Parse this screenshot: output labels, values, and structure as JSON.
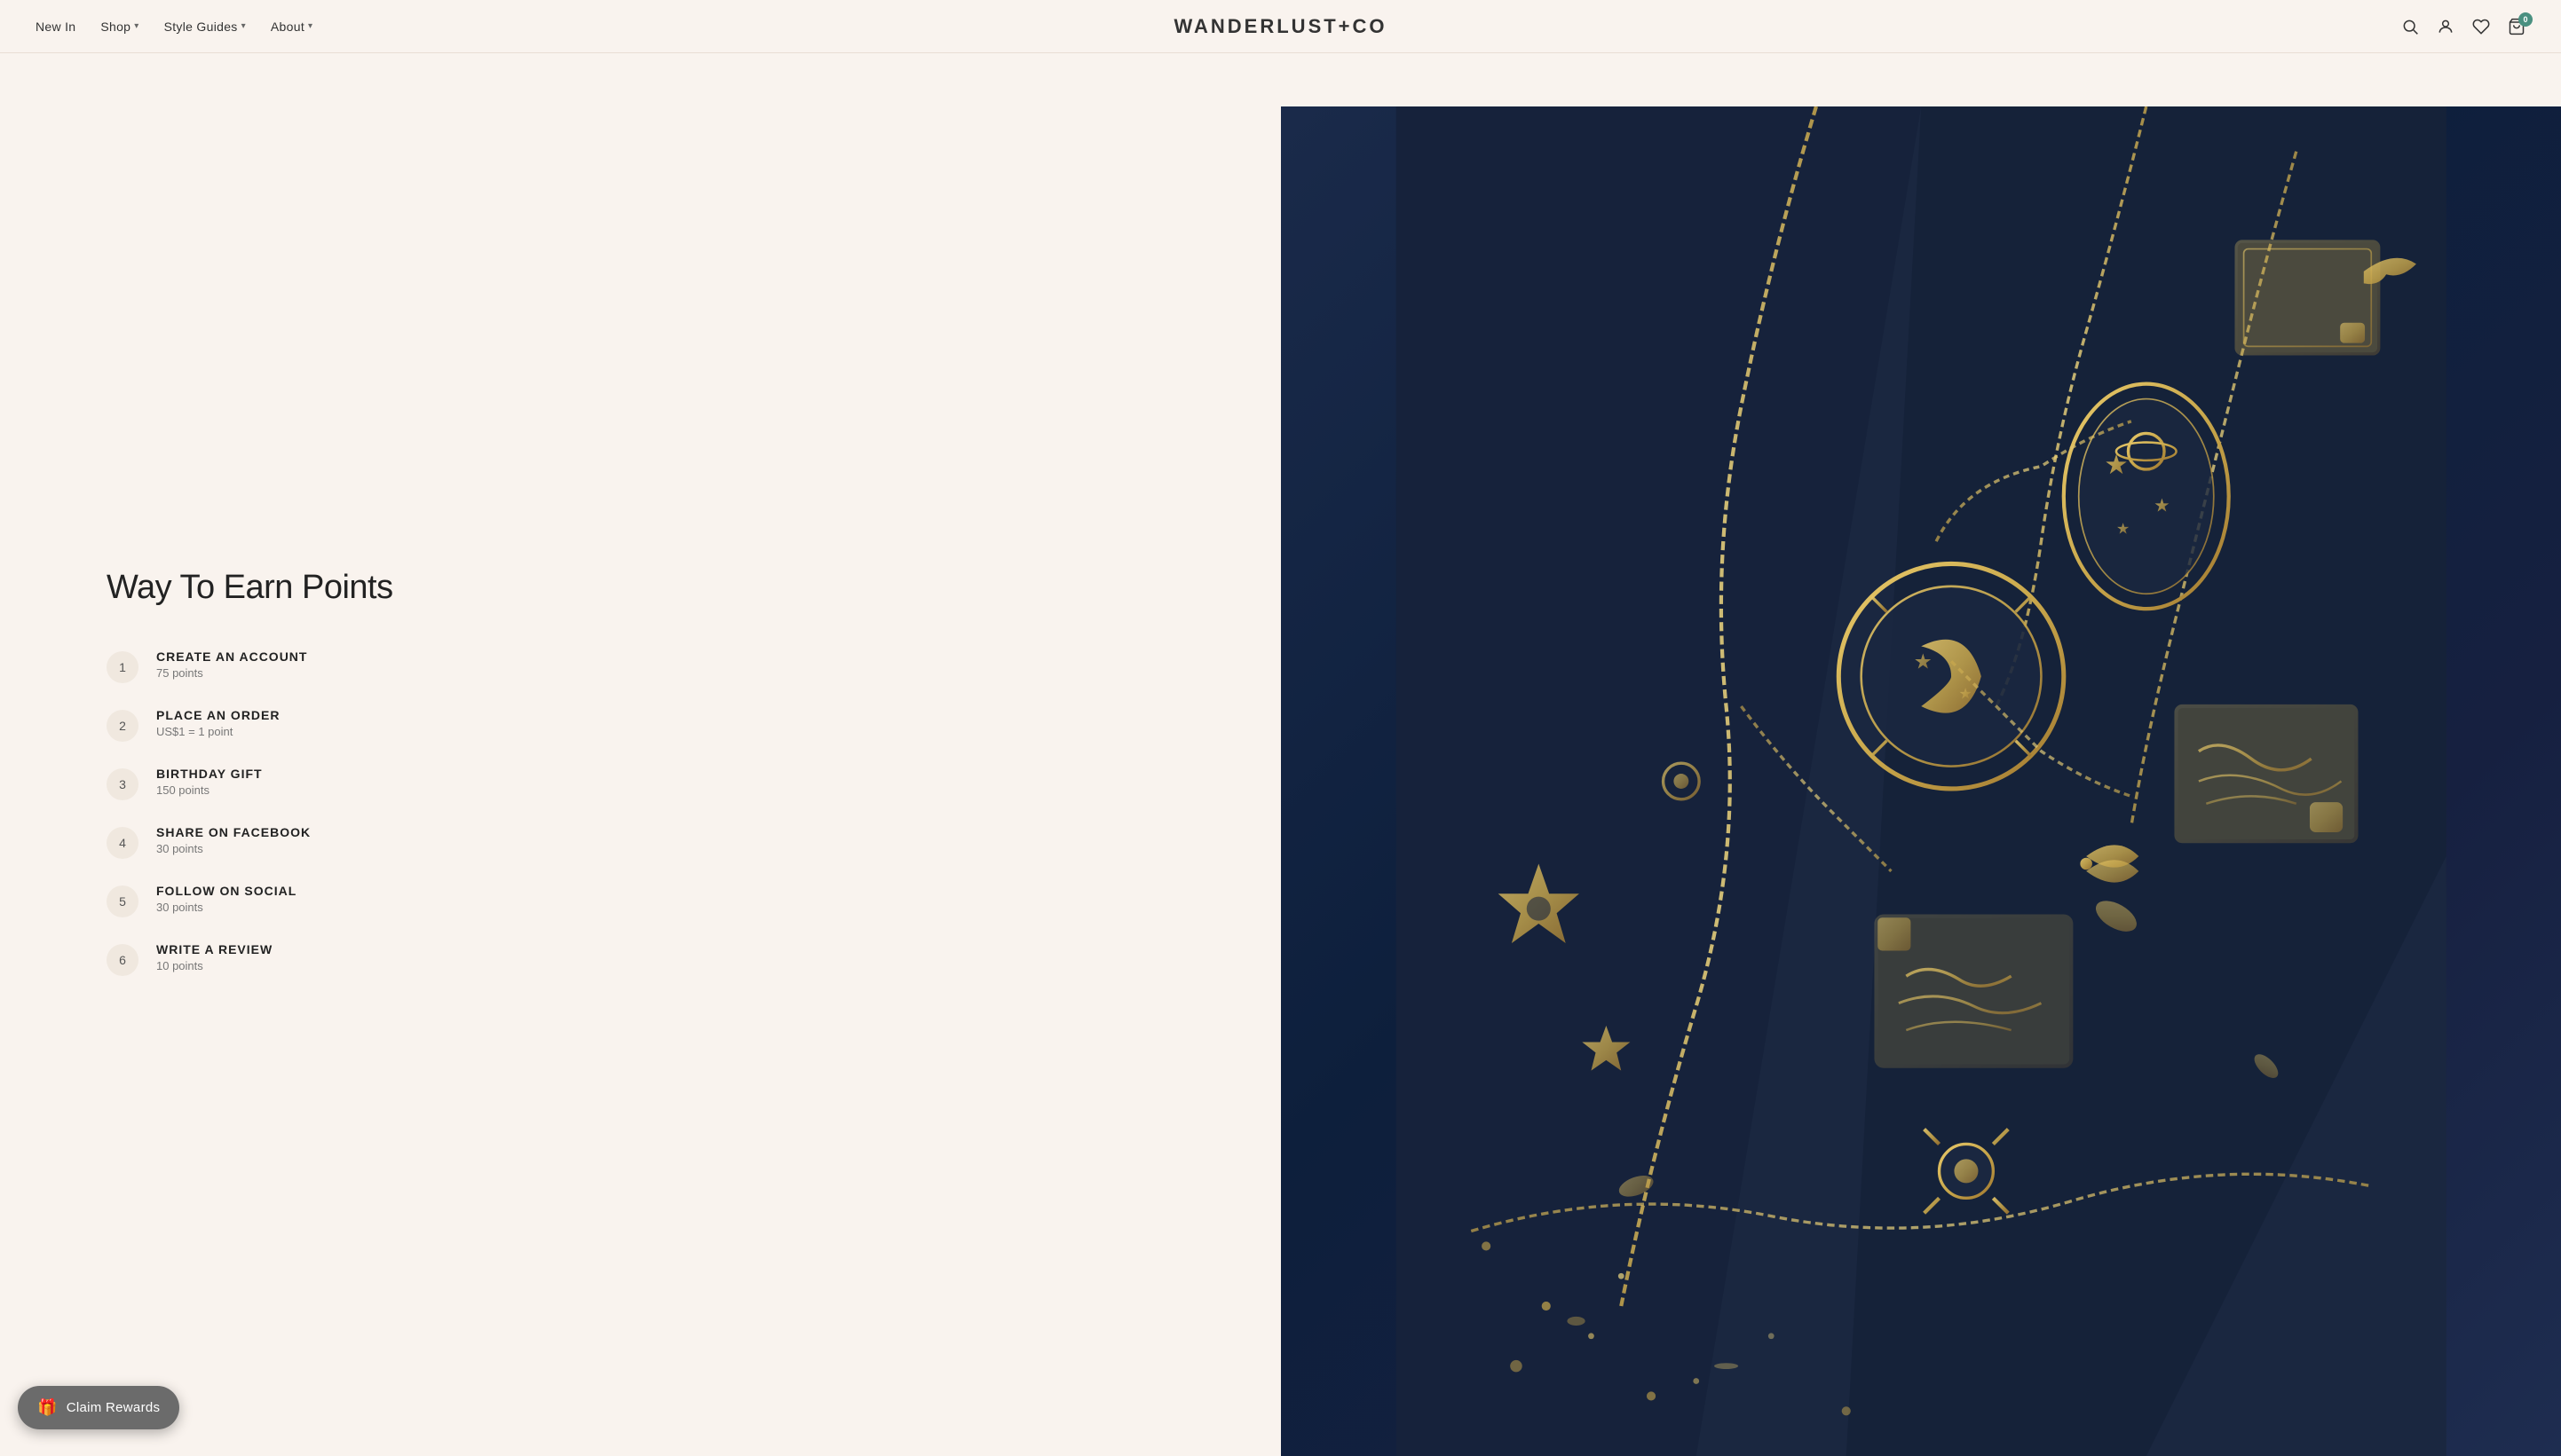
{
  "header": {
    "logo": "WANDERLUST+CO",
    "nav_items": [
      {
        "label": "New In",
        "has_dropdown": false
      },
      {
        "label": "Shop",
        "has_dropdown": true
      },
      {
        "label": "Style Guides",
        "has_dropdown": true
      },
      {
        "label": "About",
        "has_dropdown": true
      }
    ],
    "cart_count": "0"
  },
  "main": {
    "section_title": "Way To Earn Points",
    "earn_items": [
      {
        "number": "1",
        "name": "CREATE AN ACCOUNT",
        "points": "75 points"
      },
      {
        "number": "2",
        "name": "PLACE AN ORDER",
        "points": "US$1 = 1 point"
      },
      {
        "number": "3",
        "name": "BIRTHDAY GIFT",
        "points": "150 points"
      },
      {
        "number": "4",
        "name": "SHARE ON FACEBOOK",
        "points": "30 points"
      },
      {
        "number": "5",
        "name": "FOLLOW ON SOCIAL",
        "points": "30 points"
      },
      {
        "number": "6",
        "name": "WRITE A REVIEW",
        "points": "10 points"
      }
    ]
  },
  "claim_rewards": {
    "button_label": "Claim Rewards"
  },
  "icons": {
    "search": "🔍",
    "account": "👤",
    "wishlist": "♡",
    "cart": "🛍",
    "gift": "🎁",
    "chevron_down": "▾"
  }
}
